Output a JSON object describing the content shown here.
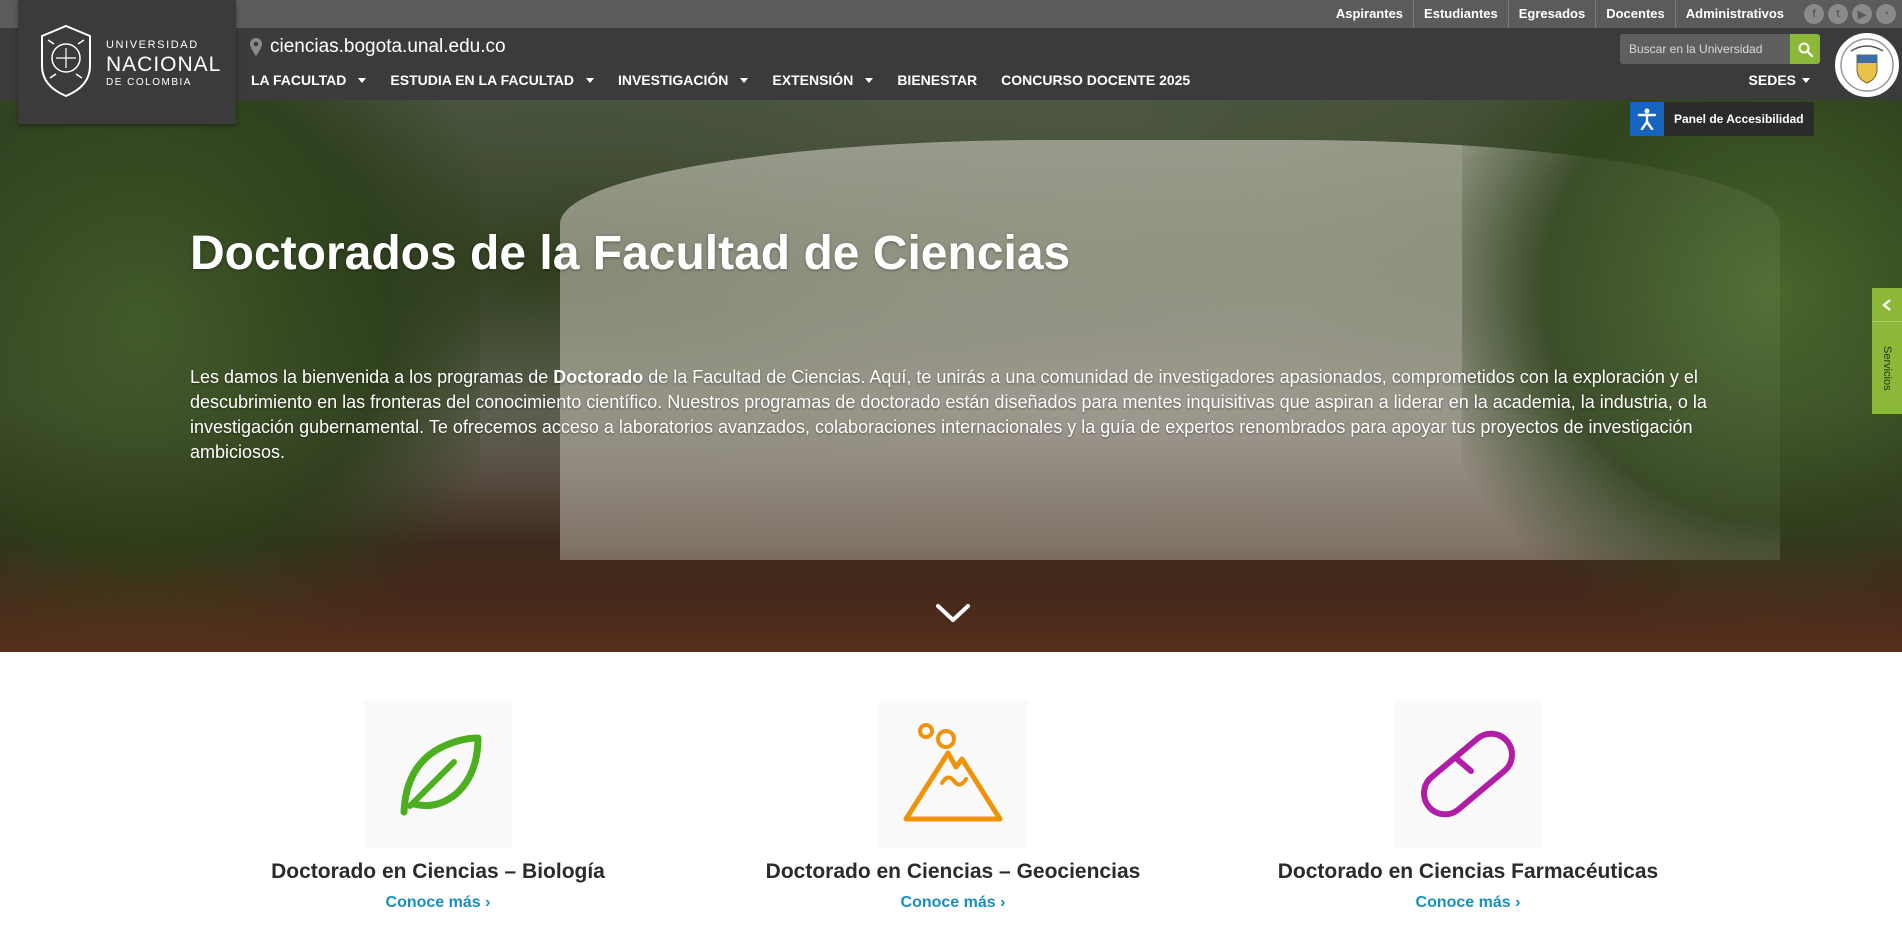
{
  "topbar": {
    "audience_links": [
      "Aspirantes",
      "Estudiantes",
      "Egresados",
      "Docentes",
      "Administrativos"
    ],
    "social_icons": [
      "facebook-icon",
      "twitter-icon",
      "youtube-icon",
      "rss-icon"
    ]
  },
  "header": {
    "logo": {
      "line1": "UNIVERSIDAD",
      "line2": "NACIONAL",
      "line3": "DE COLOMBIA"
    },
    "site_url": "ciencias.bogota.unal.edu.co",
    "search_placeholder": "Buscar en la Universidad",
    "nav": [
      {
        "label": "LA FACULTAD",
        "dropdown": true
      },
      {
        "label": "ESTUDIA EN LA FACULTAD",
        "dropdown": true
      },
      {
        "label": "INVESTIGACIÓN",
        "dropdown": true
      },
      {
        "label": "EXTENSIÓN",
        "dropdown": true
      },
      {
        "label": "BIENESTAR",
        "dropdown": false
      },
      {
        "label": "CONCURSO DOCENTE 2025",
        "dropdown": false
      }
    ],
    "sedes_label": "SEDES"
  },
  "accessibility": {
    "label": "Panel de Accesibilidad"
  },
  "side_tab": {
    "label": "Servicios"
  },
  "hero": {
    "title": "Doctorados de la Facultad de Ciencias",
    "text_before": "Les damos la bienvenida a los programas de ",
    "text_bold": "Doctorado",
    "text_after": " de la Facultad de Ciencias. Aquí, te unirás a una comunidad de investigadores apasionados, comprometidos con la exploración y el descubrimiento en las fronteras del conocimiento científico. Nuestros programas de doctorado están diseñados para mentes inquisitivas que aspiran a liderar en la academia, la industria, o la investigación gubernamental. Te ofrecemos acceso a laboratorios avanzados, colaboraciones internacionales y la guía de expertos renombrados para apoyar tus proyectos de investigación ambiciosos."
  },
  "programs": [
    {
      "title": "Doctorado en Ciencias – Biología",
      "link": "Conoce más ›",
      "icon": "leaf-icon",
      "color": "#4caf20"
    },
    {
      "title": "Doctorado en Ciencias – Geociencias",
      "link": "Conoce más ›",
      "icon": "volcano-icon",
      "color": "#f0930a"
    },
    {
      "title": "Doctorado en Ciencias Farmacéuticas",
      "link": "Conoce más ›",
      "icon": "pill-icon",
      "color": "#b01ea8"
    }
  ],
  "colors": {
    "header_bg": "#3b3b3b",
    "topbar_bg": "#5b5b5b",
    "accent_green": "#8cb83a",
    "link_blue": "#1a8fbf",
    "access_blue": "#1565c0"
  }
}
